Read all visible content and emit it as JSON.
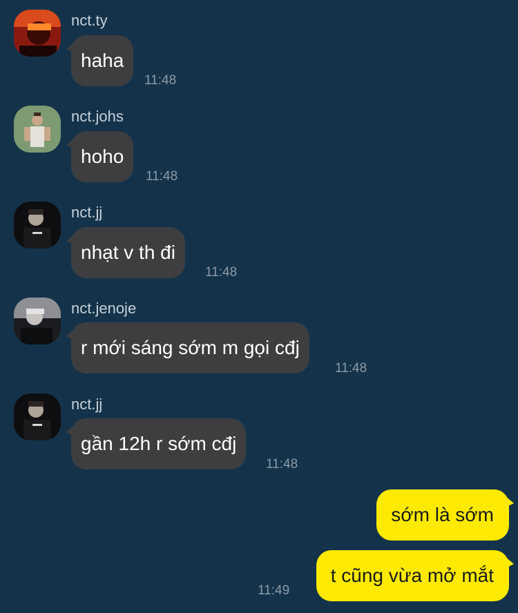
{
  "incoming": [
    {
      "user": "nct.ty",
      "text": "haha",
      "time": "11:48",
      "avatar": "avatar-ty"
    },
    {
      "user": "nct.johs",
      "text": "hoho",
      "time": "11:48",
      "avatar": "avatar-johs"
    },
    {
      "user": "nct.jj",
      "text": "nhạt v th đi",
      "time": "11:48",
      "avatar": "avatar-jj"
    },
    {
      "user": "nct.jenoje",
      "text": "r mới sáng sớm m gọi cđj",
      "time": "11:48",
      "avatar": "avatar-jenoje"
    },
    {
      "user": "nct.jj",
      "text": "gần 12h r sớm cđj",
      "time": "11:48",
      "avatar": "avatar-jj"
    }
  ],
  "outgoing": [
    {
      "text": "sớm là sớm"
    },
    {
      "text": "t cũng vừa mở mắt",
      "time": "11:49"
    }
  ],
  "colors": {
    "background": "#14334a",
    "incoming_bubble": "#3e3e40",
    "outgoing_bubble": "#fdea00"
  }
}
